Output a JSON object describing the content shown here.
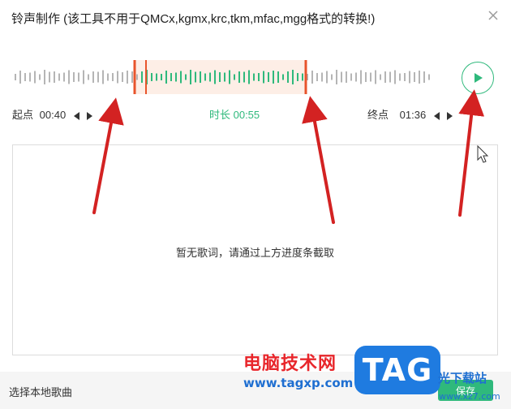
{
  "window": {
    "title": "铃声制作 (该工具不用于QMCx,kgmx,krc,tkm,mfac,mgg格式的转换!)"
  },
  "trim": {
    "start_label": "起点",
    "start_time": "00:40",
    "duration_text": "时长 00:55",
    "end_label": "终点",
    "end_time": "01:36"
  },
  "lyrics": {
    "empty_message": "暂无歌词，请通过上方进度条截取"
  },
  "footer": {
    "select_local_label": "选择本地歌曲",
    "save_label": "保存"
  },
  "watermark": {
    "site_name": "电脑技术网",
    "site_url": "www.tagxp.com",
    "tag_badge": "TAG",
    "download_text": "光下载站",
    "download_url": "www.xz7.com"
  },
  "colors": {
    "accent_green": "#2fb97c",
    "selection_marker": "#e8542c",
    "selection_fill": "#fdeee6",
    "wave_gray": "#b5b5b5",
    "annotation_red": "#d32222"
  }
}
